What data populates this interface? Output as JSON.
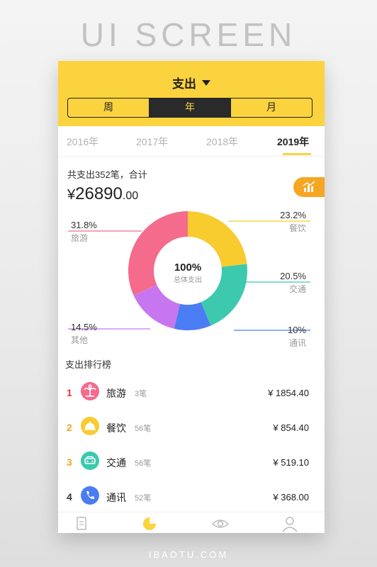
{
  "heading": "UI SCREEN",
  "watermark": "IBAOTU.COM",
  "colors": {
    "accent": "#fbd33f",
    "dark": "#2a2a2a",
    "orange": "#f5a623",
    "travel": "#f46b8c",
    "food": "#f8cb2f",
    "transport": "#3cc9ae",
    "telecom": "#4a7cf3",
    "other": "#c876ef"
  },
  "header": {
    "title": "支出",
    "caret_icon": "caret-down-icon",
    "segments": [
      {
        "label": "周",
        "active": false
      },
      {
        "label": "年",
        "active": true
      },
      {
        "label": "月",
        "active": false
      }
    ]
  },
  "years": [
    {
      "label": "2016年",
      "active": false
    },
    {
      "label": "2017年",
      "active": false
    },
    {
      "label": "2018年",
      "active": false
    },
    {
      "label": "2019年",
      "active": true
    }
  ],
  "summary": {
    "text": "共支出352笔，合计",
    "currency": "¥",
    "amount_int": "26890",
    "amount_dec": ".00",
    "chart_button_icon": "bar-chart-icon"
  },
  "chart_data": {
    "type": "pie",
    "center": {
      "value": "100%",
      "label": "总体支出"
    },
    "slices": [
      {
        "name": "餐饮",
        "label": "23.2%",
        "value": 23.2,
        "color": "#f8cb2f"
      },
      {
        "name": "交通",
        "label": "20.5%",
        "value": 20.5,
        "color": "#3cc9ae"
      },
      {
        "name": "通讯",
        "label": "10%",
        "value": 10,
        "color": "#4a7cf3"
      },
      {
        "name": "其他",
        "label": "14.5%",
        "value": 14.5,
        "color": "#c876ef"
      },
      {
        "name": "旅游",
        "label": "31.8%",
        "value": 31.8,
        "color": "#f46b8c"
      }
    ]
  },
  "ranking": {
    "title": "支出排行榜",
    "items": [
      {
        "rank": "1",
        "name": "旅游",
        "count": "3笔",
        "amount": "¥ 1854.40",
        "icon": "palm-tree-icon",
        "color": "#f46b8c",
        "rank_color": "#e53935"
      },
      {
        "rank": "2",
        "name": "餐饮",
        "count": "56笔",
        "amount": "¥ 854.40",
        "icon": "food-cloche-icon",
        "color": "#f8cb2f",
        "rank_color": "#f5a623"
      },
      {
        "rank": "3",
        "name": "交通",
        "count": "56笔",
        "amount": "¥ 519.10",
        "icon": "car-icon",
        "color": "#3cc9ae",
        "rank_color": "#f5a623"
      },
      {
        "rank": "4",
        "name": "通讯",
        "count": "52笔",
        "amount": "¥ 368.00",
        "icon": "phone-icon",
        "color": "#4a7cf3",
        "rank_color": "#333333"
      }
    ]
  },
  "nav": [
    {
      "icon": "bill-icon",
      "active": false
    },
    {
      "icon": "pie-chart-icon",
      "active": true
    },
    {
      "icon": "eye-icon",
      "active": false
    },
    {
      "icon": "user-icon",
      "active": false
    }
  ]
}
